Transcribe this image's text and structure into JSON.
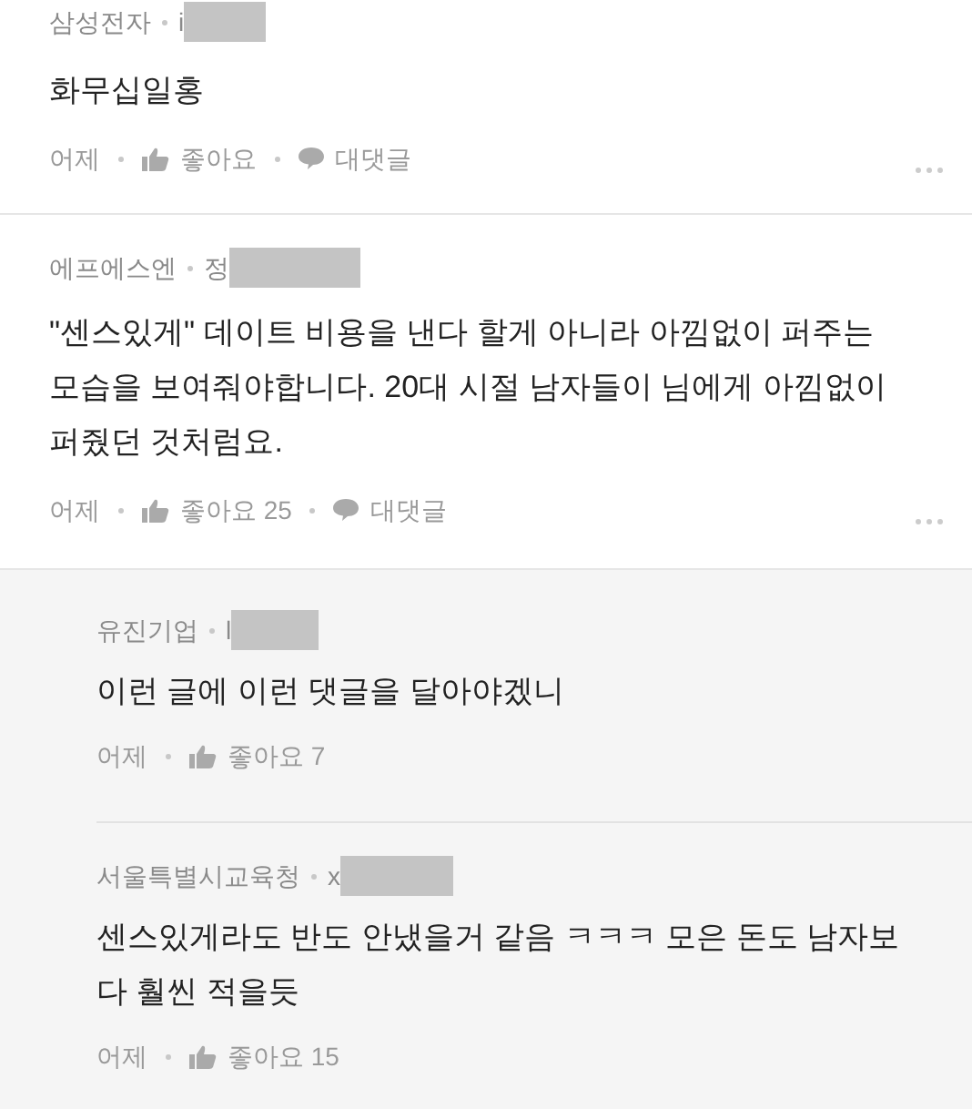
{
  "comments": [
    {
      "author": "삼성전자",
      "handle": "i",
      "text": "화무십일홍",
      "time": "어제",
      "like_label": "좋아요",
      "reply_label": "대댓글"
    },
    {
      "author": "에프에스엔",
      "handle": "정",
      "text": "\"센스있게\" 데이트 비용을 낸다 할게 아니라 아낌없이 퍼주는 모습을 보여줘야합니다. 20대 시절 남자들이 님에게 아낌없이 퍼줬던 것처럼요.",
      "time": "어제",
      "like_label": "좋아요 25",
      "reply_label": "대댓글",
      "replies": [
        {
          "author": "유진기업",
          "handle": "l",
          "text": "이런 글에 이런 댓글을 달아야겠니",
          "time": "어제",
          "like_label": "좋아요 7"
        },
        {
          "author": "서울특별시교육청",
          "handle": "x",
          "text": "센스있게라도 반도 안냈을거 같음 ㅋㅋㅋ 모은 돈도 남자보다 훨씬 적을듯",
          "time": "어제",
          "like_label": "좋아요 15"
        }
      ]
    }
  ]
}
